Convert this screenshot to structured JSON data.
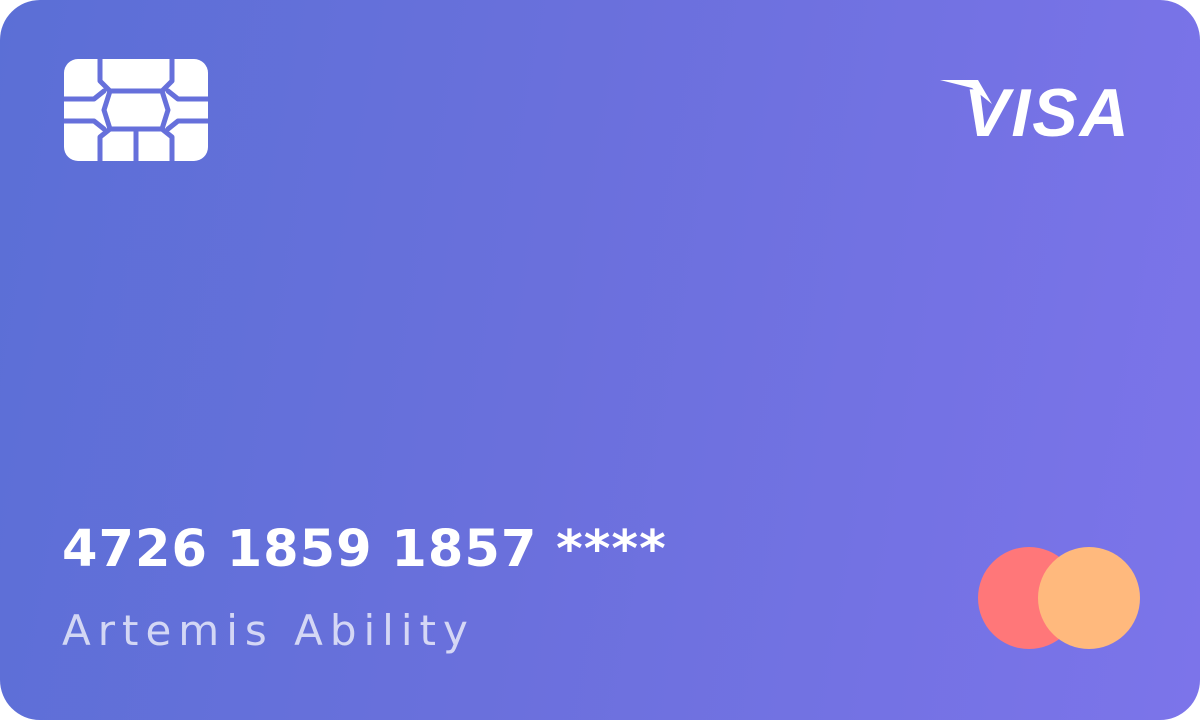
{
  "card": {
    "number": "4726 1859 1857 ****",
    "holder_name": "Artemis Ability",
    "brand": "VISA",
    "colors": {
      "gradient_start": "#5b6fd6",
      "gradient_end": "#7c74ea",
      "chip": "#ffffff",
      "circle_left": "#ff7779",
      "circle_right": "#ffb97d"
    }
  }
}
